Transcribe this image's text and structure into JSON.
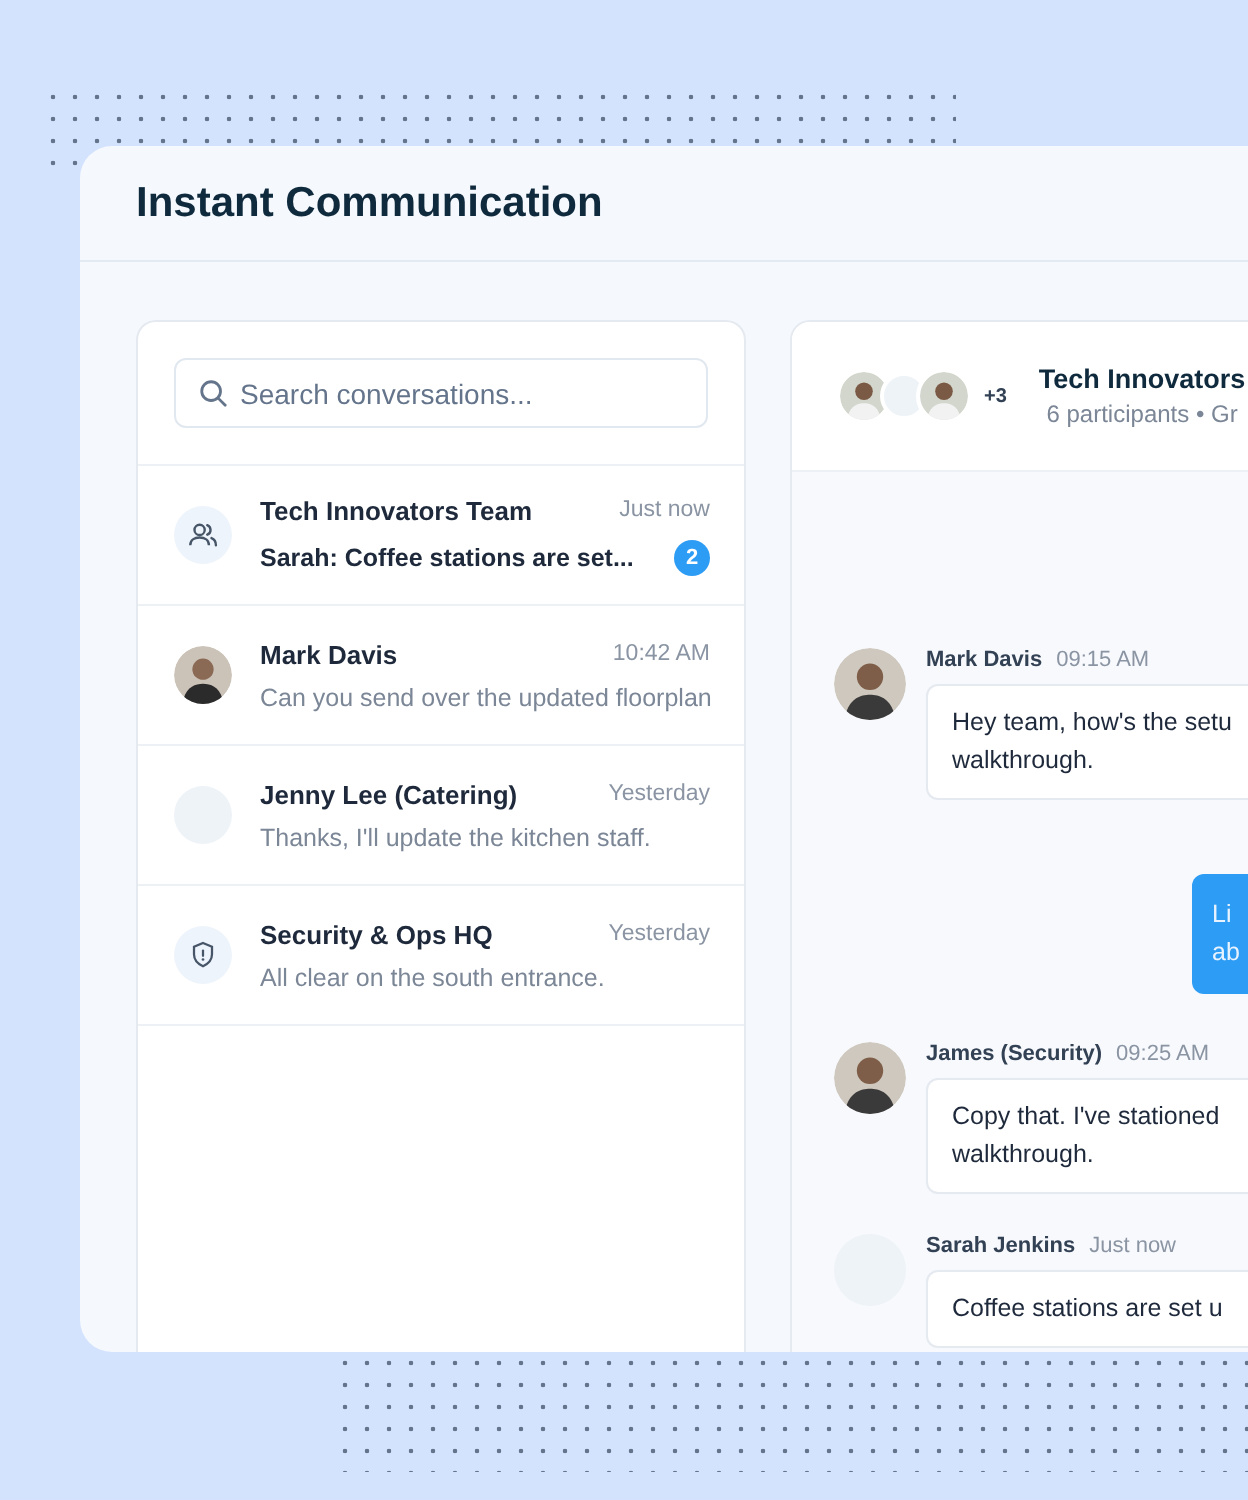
{
  "window": {
    "title": "Instant Communication"
  },
  "search": {
    "placeholder": "Search conversations..."
  },
  "conversations": [
    {
      "kind": "group",
      "name": "Tech Innovators Team",
      "time": "Just now",
      "preview": "Sarah: Coffee stations are set...",
      "unread": true,
      "badge": "2"
    },
    {
      "kind": "photo",
      "name": "Mark Davis",
      "time": "10:42 AM",
      "preview": "Can you send over the updated floorplan",
      "unread": false
    },
    {
      "kind": "blank",
      "name": "Jenny Lee (Catering)",
      "time": "Yesterday",
      "preview": "Thanks, I'll update the kitchen staff.",
      "unread": false
    },
    {
      "kind": "shield",
      "name": "Security & Ops HQ",
      "time": "Yesterday",
      "preview": "All clear on the south entrance.",
      "unread": false
    }
  ],
  "chat": {
    "avatars": [
      {
        "kind": "photo"
      },
      {
        "kind": "blank"
      },
      {
        "kind": "photo"
      }
    ],
    "more": "+3",
    "title": "Tech Innovators",
    "subtitle": "6 participants • Gr",
    "messages": [
      {
        "kind": "incoming",
        "avatar": {
          "kind": "photo"
        },
        "sender": "Mark Davis",
        "time": "09:15 AM",
        "lines": [
          "Hey team, how's the setu",
          "walkthrough."
        ]
      },
      {
        "kind": "outgoing",
        "lines": [
          "Li",
          "ab"
        ]
      },
      {
        "kind": "incoming",
        "avatar": {
          "kind": "photo"
        },
        "sender": "James (Security)",
        "time": "09:25 AM",
        "lines": [
          "Copy that. I've stationed",
          "walkthrough."
        ]
      },
      {
        "kind": "incoming",
        "avatar": {
          "kind": "blank"
        },
        "sender": "Sarah Jenkins",
        "time": "Just now",
        "lines": [
          "Coffee stations are set u"
        ]
      }
    ]
  }
}
